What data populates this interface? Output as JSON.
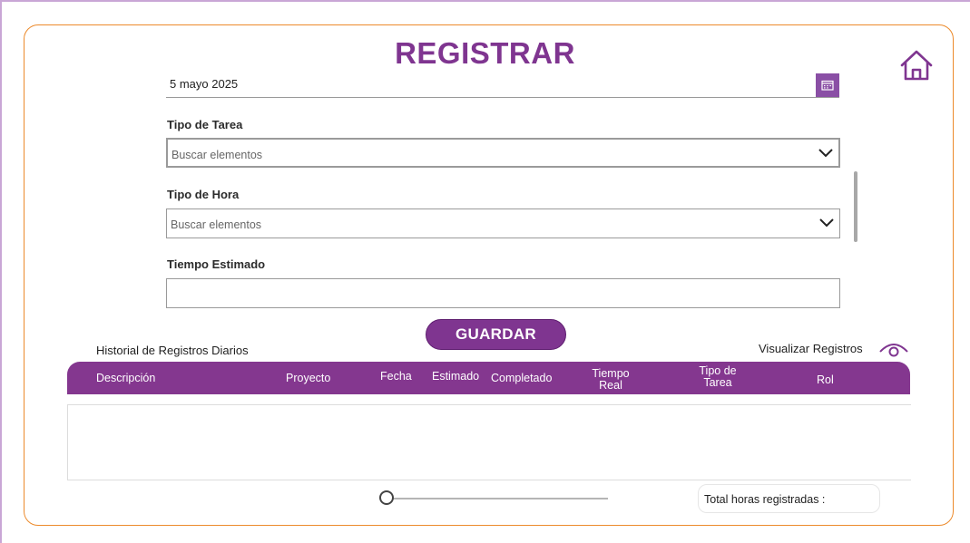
{
  "header": {
    "title": "REGISTRAR",
    "home_icon": "home-icon"
  },
  "form": {
    "date_value": "5 mayo 2025",
    "calendar_icon": "calendar-icon",
    "tipo_tarea": {
      "label": "Tipo de Tarea",
      "placeholder": "Buscar elementos"
    },
    "tipo_hora": {
      "label": "Tipo de Hora",
      "placeholder": "Buscar elementos"
    },
    "tiempo_estimado": {
      "label": "Tiempo Estimado",
      "value": ""
    },
    "save_label": "GUARDAR"
  },
  "history": {
    "title": "Historial de Registros Diarios",
    "visualize_label": "Visualizar Registros",
    "visualize_icon": "eye-icon",
    "columns": {
      "descripcion": "Descripción",
      "proyecto": "Proyecto",
      "fecha": "Fecha",
      "estimado": "Estimado",
      "completado": "Completado",
      "tiempo_real_1": "Tiempo",
      "tiempo_real_2": "Real",
      "tipo_tarea_1": "Tipo de",
      "tipo_tarea_2": "Tarea",
      "rol": "Rol"
    },
    "rows": [],
    "total_label": "Total horas registradas :",
    "slider_value": 0
  },
  "colors": {
    "brand_purple": "#7f3590",
    "header_purple": "#84378f",
    "card_border": "#ec8a2b"
  }
}
